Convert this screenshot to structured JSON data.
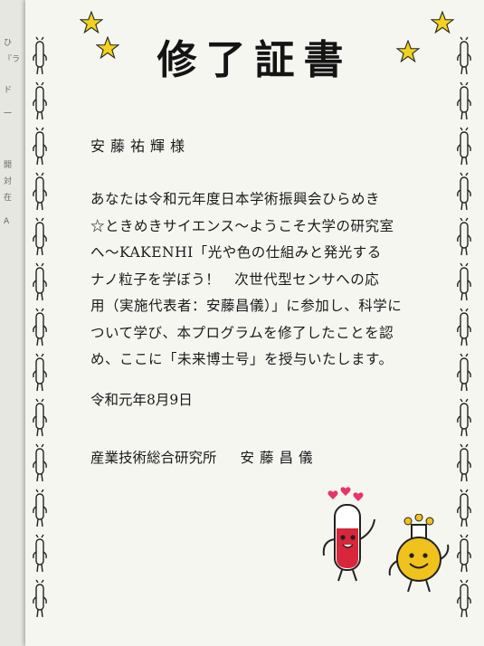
{
  "certificate": {
    "title": "修了証書",
    "recipient": "安藤祐輝様",
    "body_lines": [
      "あなたは令和元年度日本学術振興会ひらめき",
      "☆ときめきサイエンス～ようこそ大学の研究室",
      "へ～KAKENHI「光や色の仕組みと発光する",
      "ナノ粒子を学ぼう！　次世代型センサへの応",
      "用（実施代表者：安藤昌儀）」に参加し、科学に",
      "ついて学び、本プログラムを修了したことを認",
      "め、ここに「未来博士号」を授与いたします。"
    ],
    "date": "令和元年8月9日",
    "issuer_org": "産業技術総合研究所",
    "issuer_name": "安藤昌儀"
  },
  "background_doc": {
    "fragments": [
      "ひ",
      "『ラ",
      "ド",
      "一",
      "開",
      "対",
      "在",
      "A"
    ]
  },
  "decor": {
    "star_color": "#f2d21d",
    "tube_color": "#d8263a",
    "flask_color": "#f0c21c",
    "heart_color": "#e8336d"
  }
}
